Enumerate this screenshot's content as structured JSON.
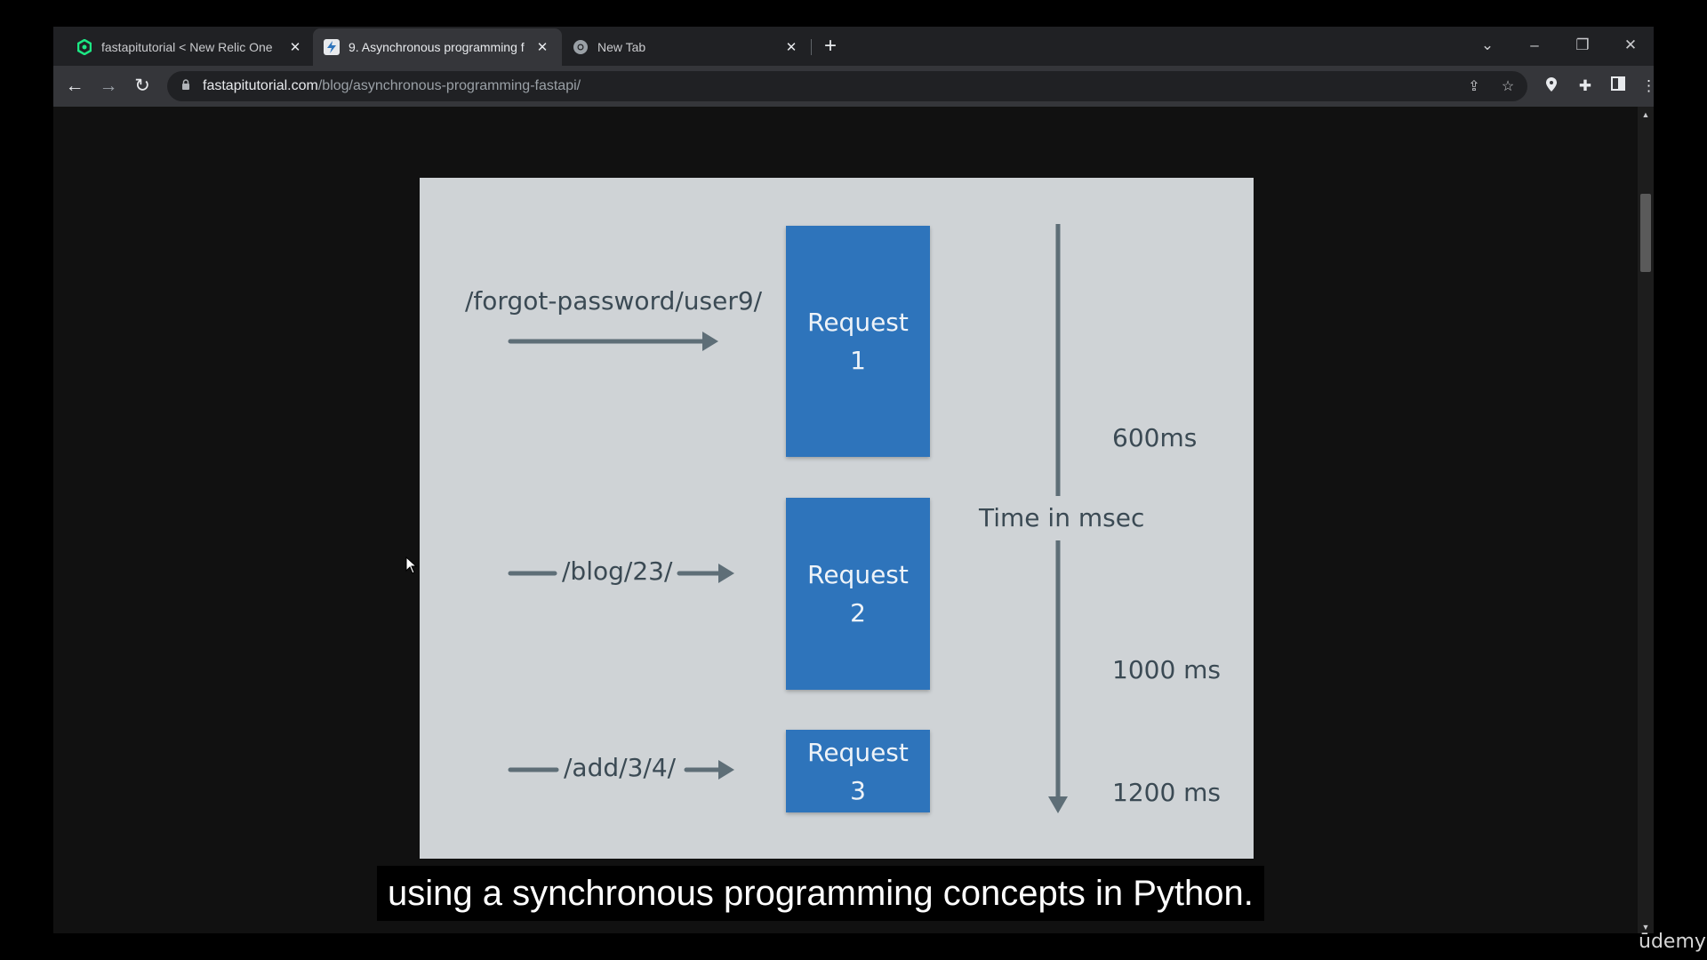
{
  "browser": {
    "tabs": [
      {
        "title": "fastapitutorial < New Relic One",
        "icon": "new-relic-logo",
        "active": false
      },
      {
        "title": "9. Asynchronous programming f",
        "icon": "fastapitutorial-logo",
        "active": true
      },
      {
        "title": "New Tab",
        "icon": "chrome-logo",
        "active": false
      }
    ],
    "new_tab_glyph": "+",
    "url_domain": "fastapitutorial.com",
    "url_path": "/blog/asynchronous-programming-fastapi/"
  },
  "slide": {
    "routes": [
      "/forgot-password/user9/",
      "/blog/23/",
      "/add/3/4/"
    ],
    "requests": [
      {
        "line1": "Request",
        "line2": "1"
      },
      {
        "line1": "Request",
        "line2": "2"
      },
      {
        "line1": "Request",
        "line2": "3"
      }
    ],
    "time_label": "Time in msec",
    "time_marks": [
      "600ms",
      "1000 ms",
      "1200 ms"
    ]
  },
  "caption": "using a synchronous programming concepts in Python.",
  "watermark": "ūdemy",
  "colors": {
    "request_box": "#2e74bb",
    "slide_bg": "#cfd3d6",
    "arrow": "#5e6e77",
    "tab_strip": "#202124",
    "toolbar": "#35363a"
  }
}
